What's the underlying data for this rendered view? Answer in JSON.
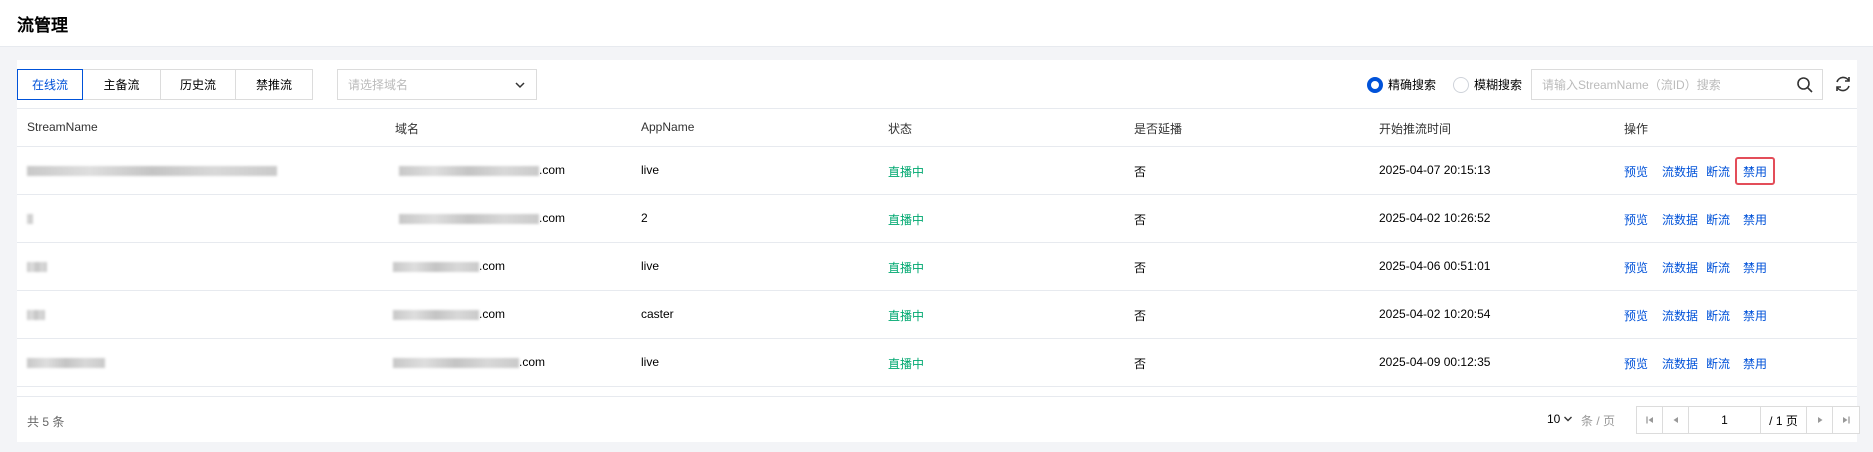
{
  "page": {
    "title": "流管理"
  },
  "tabs": [
    {
      "label": "在线流",
      "active": true
    },
    {
      "label": "主备流",
      "active": false
    },
    {
      "label": "历史流",
      "active": false
    },
    {
      "label": "禁推流",
      "active": false
    }
  ],
  "domain_select": {
    "placeholder": "请选择域名"
  },
  "search": {
    "exact_label": "精确搜索",
    "fuzzy_label": "模糊搜索",
    "mode": "exact",
    "placeholder": "请输入StreamName（流ID）搜索",
    "value": ""
  },
  "table": {
    "columns": [
      "StreamName",
      "域名",
      "AppName",
      "状态",
      "是否延播",
      "开始推流时间",
      "操作"
    ],
    "rows": [
      {
        "domain_suffix": ".com",
        "app": "live",
        "status": "直播中",
        "delay": "否",
        "start": "2025-04-07 20:15:13"
      },
      {
        "domain_suffix": ".com",
        "app": "2",
        "status": "直播中",
        "delay": "否",
        "start": "2025-04-02 10:26:52"
      },
      {
        "domain_suffix": ".com",
        "app": "live",
        "status": "直播中",
        "delay": "否",
        "start": "2025-04-06 00:51:01"
      },
      {
        "domain_suffix": ".com",
        "app": "caster",
        "status": "直播中",
        "delay": "否",
        "start": "2025-04-02 10:20:54"
      },
      {
        "domain_suffix": ".com",
        "app": "live",
        "status": "直播中",
        "delay": "否",
        "start": "2025-04-09 00:12:35"
      }
    ],
    "actions": {
      "preview": "预览",
      "stream_data": "流数据",
      "cut": "断流",
      "disable": "禁用"
    }
  },
  "pagination": {
    "total_text": "共 5 条",
    "page_size": "10",
    "page_size_unit": "条 / 页",
    "current_page": "1",
    "total_pages_text": "/ 1 页"
  },
  "colors": {
    "accent": "#0052d9",
    "live": "#00a870",
    "highlight": "#e34d59"
  }
}
